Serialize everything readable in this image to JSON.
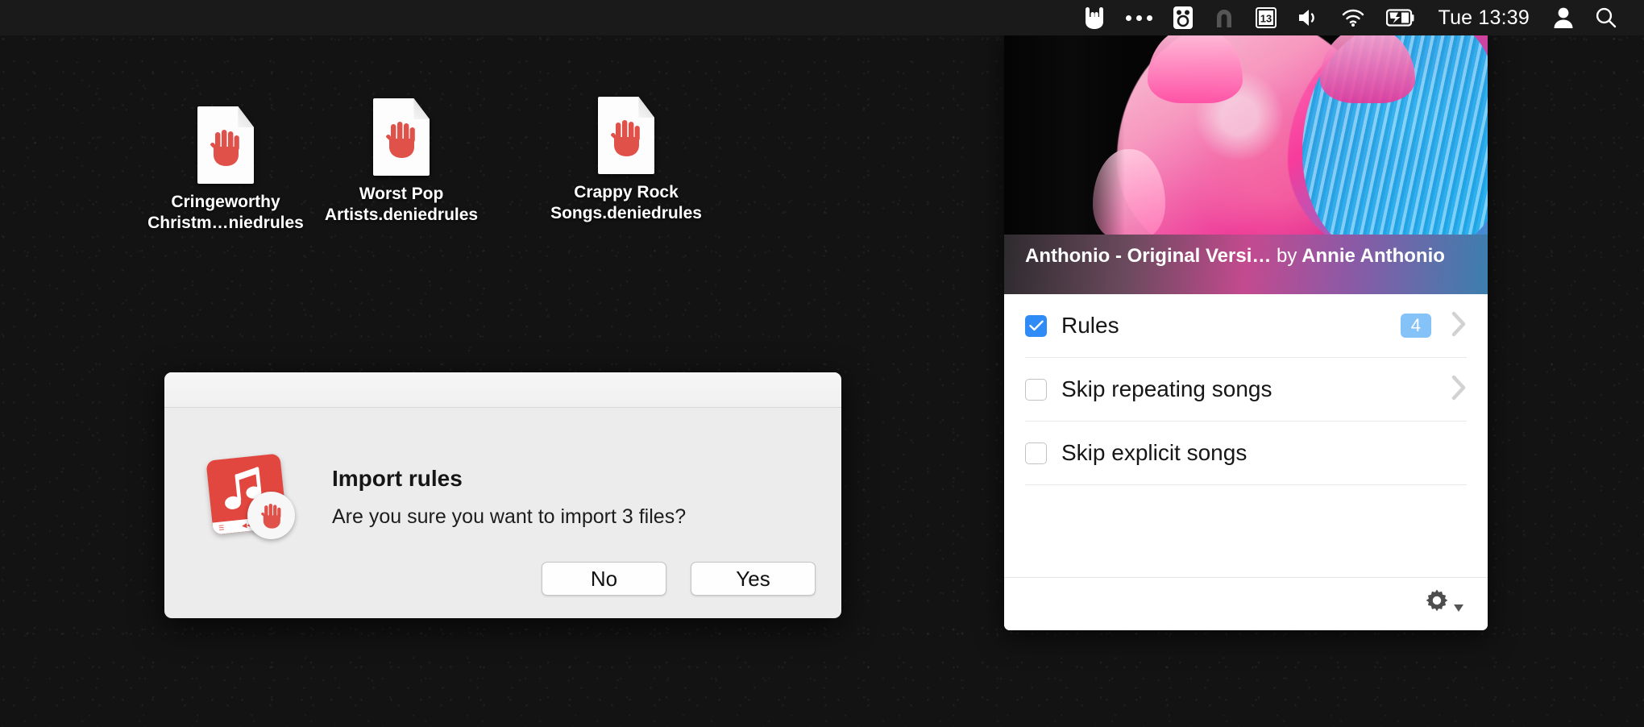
{
  "menubar": {
    "icons": [
      {
        "name": "rock-hand-icon",
        "glyph": "rock-hand"
      },
      {
        "name": "ellipsis-icon",
        "glyph": "dots"
      },
      {
        "name": "owl-icon",
        "glyph": "owl"
      },
      {
        "name": "magnet-icon",
        "glyph": "magnet"
      },
      {
        "name": "calendar-icon",
        "glyph": "calendar",
        "label": "13"
      },
      {
        "name": "volume-icon",
        "glyph": "speaker"
      },
      {
        "name": "wifi-icon",
        "glyph": "wifi"
      },
      {
        "name": "battery-charging-icon",
        "glyph": "battery"
      }
    ],
    "clock": "Tue 13:39",
    "user_icon": "user-icon",
    "search_icon": "search-icon",
    "calendar_day": "13"
  },
  "desktop": {
    "files": [
      {
        "name": "Cringeworthy Christm…niedrules",
        "line1": "Cringeworthy",
        "line2": "Christm…niedrules",
        "icon": "denied-rules-document-icon"
      },
      {
        "name": "Worst Pop Artists.deniedrules",
        "line1": "Worst Pop",
        "line2": "Artists.deniedrules",
        "icon": "denied-rules-document-icon"
      },
      {
        "name": "Crappy Rock Songs.deniedrules",
        "line1": "Crappy Rock",
        "line2": "Songs.deniedrules",
        "icon": "denied-rules-document-icon"
      }
    ]
  },
  "dialog": {
    "title": "Import rules",
    "message": "Are you sure you want to import 3 files?",
    "icon": "music-rules-denied-icon",
    "card_strip_left": "☰",
    "card_strip_mid": "◀◀",
    "buttons": [
      {
        "label": "No",
        "name": "no-button"
      },
      {
        "label": "Yes",
        "name": "yes-button"
      }
    ]
  },
  "widget": {
    "album_art_alt": "album-art",
    "track_title": "Anthonio - Original Versi…",
    "track_by": "by",
    "track_artist": "Annie Anthonio",
    "rules": [
      {
        "label": "Rules",
        "checked": true,
        "badge": "4",
        "chevron": true
      },
      {
        "label": "Skip repeating songs",
        "checked": false,
        "badge": "",
        "chevron": true
      },
      {
        "label": "Skip explicit songs",
        "checked": false,
        "badge": "",
        "chevron": false
      }
    ],
    "footer_icon": "gear-icon"
  },
  "colors": {
    "accent_blue": "#2f8bf5",
    "badge_blue": "#85c2f7",
    "red": "#e2473f",
    "menubar_bg": "#1a1a1a",
    "dialog_bg": "#ececec"
  }
}
